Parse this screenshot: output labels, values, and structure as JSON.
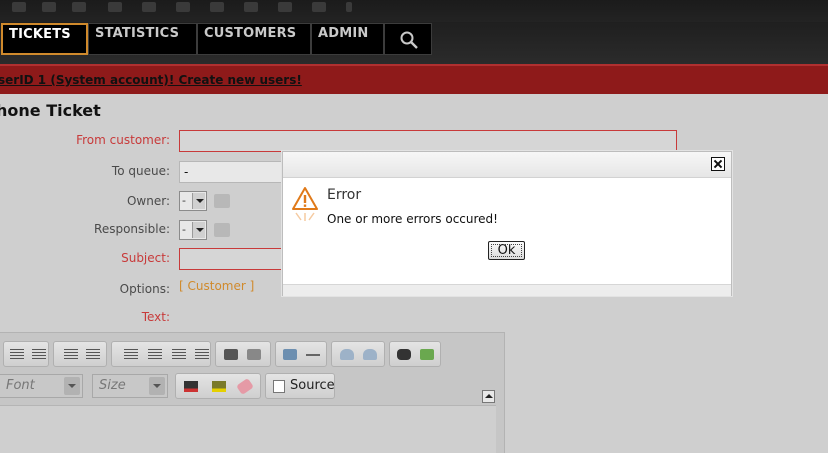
{
  "nav": {
    "items": [
      {
        "label": "TICKETS",
        "active": true
      },
      {
        "label": "STATISTICS",
        "active": false
      },
      {
        "label": "CUSTOMERS",
        "active": false
      },
      {
        "label": "ADMIN",
        "active": false
      }
    ],
    "search_icon": "search-icon"
  },
  "warning": {
    "text": "serID 1 (System account)! Create new users!"
  },
  "page": {
    "title": "hone Ticket",
    "form": {
      "from_customer_label": "From customer:",
      "to_queue_label": "To queue:",
      "to_queue_value": "-",
      "owner_label": "Owner:",
      "owner_value": "-",
      "responsible_label": "Responsible:",
      "responsible_value": "-",
      "subject_label": "Subject:",
      "options_label": "Options:",
      "options_link": "[ Customer ]",
      "text_label": "Text:"
    },
    "editor": {
      "font_placeholder": "Font",
      "size_placeholder": "Size",
      "source_label": "Source"
    }
  },
  "modal": {
    "title": "Error",
    "message": "One or more errors occured!",
    "ok_label": "Ok",
    "icon": "warning-icon"
  },
  "colors": {
    "accent": "#d08a2c",
    "warning_bar": "#8e1a1a",
    "error_label": "#c83a3a"
  }
}
